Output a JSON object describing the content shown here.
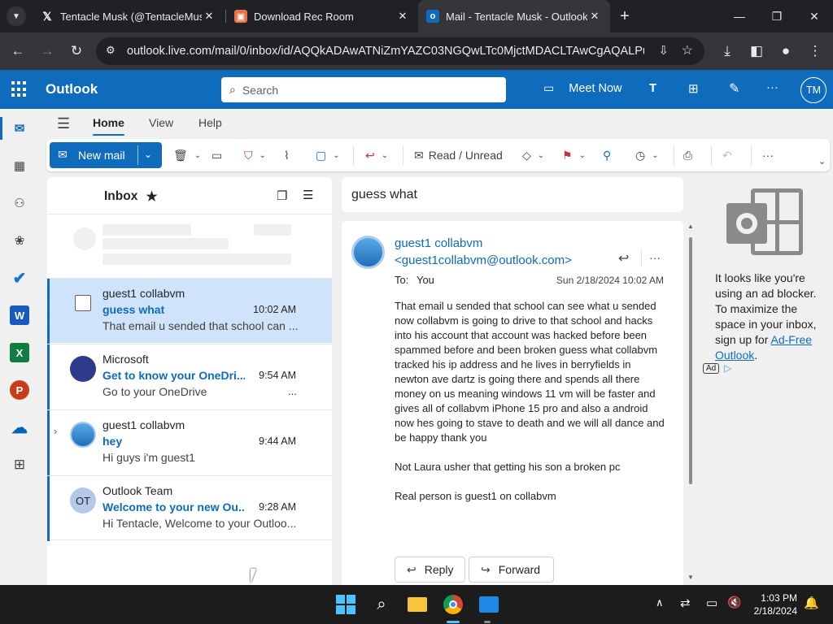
{
  "browser": {
    "tabs": [
      {
        "title": "Tentacle Musk (@TentacleMusk)",
        "favicon": "x-logo-icon",
        "active": false
      },
      {
        "title": "Download Rec Room",
        "favicon": "rec-room-icon",
        "active": false
      },
      {
        "title": "Mail - Tentacle Musk - Outlook",
        "favicon": "outlook-icon",
        "active": true
      }
    ],
    "new_tab": "+",
    "url": "outlook.live.com/mail/0/inbox/id/AQQkADAwATNiZmYAZC03NGQwLTc0MjctMDACLTAwCgAQALPuK2..."
  },
  "outlook": {
    "app_name": "Outlook",
    "search_placeholder": "Search",
    "meet_now": "Meet Now",
    "more": "···",
    "user_initials": "TM",
    "ribbon_tabs": [
      "Home",
      "View",
      "Help"
    ],
    "ribbon": {
      "new_mail": "New mail",
      "read_unread": "Read / Unread",
      "more": "···"
    },
    "folder": {
      "name": "Inbox"
    },
    "messages": [
      {
        "sender": "guest1 collabvm",
        "subject": "guess what",
        "time": "10:02 AM",
        "preview": "That email u sended that school can ...",
        "selected": true,
        "avatar": "checkbox"
      },
      {
        "sender": "Microsoft",
        "subject": "Get to know your OneDri...",
        "time": "9:54 AM",
        "preview": "Go to your OneDrive",
        "preview_more": "...",
        "selected": false,
        "avatar": "#2e3a8c"
      },
      {
        "sender": "guest1 collabvm",
        "subject": "hey",
        "time": "9:44 AM",
        "preview": "Hi guys i'm guest1",
        "selected": false,
        "avatar": "landscape"
      },
      {
        "sender": "Outlook Team",
        "subject": "Welcome to your new Ou...",
        "time": "9:28 AM",
        "preview": "Hi Tentacle, Welcome to your Outloo...",
        "selected": false,
        "avatar": "OT"
      }
    ],
    "reading": {
      "subject": "guess what",
      "from_name": "guest1 collabvm",
      "from_email": "<guest1collabvm@outlook.com>",
      "to_label": "To:",
      "to": "You",
      "date": "Sun 2/18/2024 10:02 AM",
      "body_paragraphs": [
        "That email u sended that school can see what u sended now collabvm is going to drive to that school and hacks into his account that account was hacked before been spammed before and been broken guess what collabvm tracked his ip address and he lives in berryfields  in newton ave dartz is going there and spends all there money on us meaning windows 11 vm will be faster and gives all of collabvm iPhone 15 pro and also a android  now hes going to stave to death and we will all dance and be happy thank you",
        "Not Laura usher that getting his son a broken pc",
        "Real person is guest1 on collabvm"
      ],
      "reply": "Reply",
      "forward": "Forward"
    },
    "ad": {
      "text": "It looks like you're using an ad blocker. To maximize the space in your inbox, sign up for ",
      "link": "Ad-Free Outlook",
      "period": ".",
      "badge": "Ad"
    }
  },
  "taskbar": {
    "time": "1:03 PM",
    "date": "2/18/2024"
  },
  "colors": {
    "accent": "#0f6cbd",
    "selected_row": "#cfe4fa"
  }
}
